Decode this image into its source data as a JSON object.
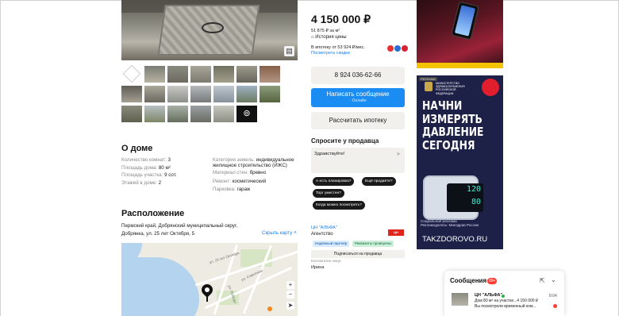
{
  "listing": {
    "price": "4 150 000 ₽",
    "price_per_sqm": "51 875 ₽ за м²",
    "price_history": "История цены",
    "mortgage_line": "В ипотеку от 53 924 ₽/мес.",
    "mortgage_offers": "Посмотреть скидки"
  },
  "actions": {
    "phone": "8 924 036-62-66",
    "write": "Написать сообщение",
    "write_status": "Онлайн",
    "calc": "Рассчитать ипотеку"
  },
  "ask": {
    "title": "Спросите у продавца",
    "default_message": "Здравствуйте!",
    "chips": [
      "А есть планировка?",
      "Ещё продаёте?",
      "Торг уместен?",
      "Когда можно посмотреть?"
    ]
  },
  "agent": {
    "name": "ЦН \"АЛЬФА\"",
    "type": "Агентство",
    "logo_text": "ЦН АЛЬФА",
    "tags": [
      "Надёжный партнёр",
      "Реквизиты проверены"
    ],
    "subscribe": "Подписаться на продавца",
    "contact_label": "Контактное лицо",
    "contact_name": "Ирина"
  },
  "about": {
    "title": "О доме",
    "left": [
      {
        "label": "Количество комнат:",
        "value": "3"
      },
      {
        "label": "Площадь дома:",
        "value": "80 м²"
      },
      {
        "label": "Площадь участка:",
        "value": "9 сот."
      },
      {
        "label": "Этажей в доме:",
        "value": "2"
      }
    ],
    "right": [
      {
        "label": "Категория земель:",
        "value": "индивидуальное жилищное строительство (ИЖС)"
      },
      {
        "label": "Материал стен:",
        "value": "бревно"
      },
      {
        "label": "Ремонт:",
        "value": "косметический"
      },
      {
        "label": "Парковка:",
        "value": "гараж"
      }
    ]
  },
  "location": {
    "title": "Расположение",
    "address_line1": "Пермский край, Добрянский муниципальный округ,",
    "address_line2": "Добрянка, ул. 25 лет Октября, 5",
    "hide_map": "Скрыть карту",
    "map_labels": [
      "ул. 25 лет Октября",
      "ул. Советская",
      "ул. Победы"
    ],
    "zoom_in": "+",
    "zoom_out": "−"
  },
  "gallery": {
    "more": "⊚"
  },
  "ads": {
    "label": "РЕКЛАМА",
    "org": "МИНИСТЕРСТВО ЗДРАВООХРАНЕНИЯ РОССИЙСКОЙ ФЕДЕРАЦИИ",
    "headline": [
      "НАЧНИ",
      "ИЗМЕРЯТЬ",
      "ДАВЛЕНИЕ",
      "СЕГОДНЯ"
    ],
    "sys": "120",
    "dia": "80",
    "footer1": "Социальная реклама",
    "footer2": "Рекламодатель: Минздрав России",
    "url": "TAKZDOROVO.RU"
  },
  "messages": {
    "title": "Сообщения",
    "count": "99+",
    "sender": "ЦН \"АЛЬФА\"",
    "time": "8:04",
    "preview1": "Дом 80 м² на участке...",
    "preview_price": "4 150 000 ₽",
    "preview2": "Вы посмотрели временный ком..."
  },
  "colors": {
    "accent": "#1b8cf2",
    "button_grey": "#f1f0ec",
    "ad_bg": "#1e2147"
  }
}
